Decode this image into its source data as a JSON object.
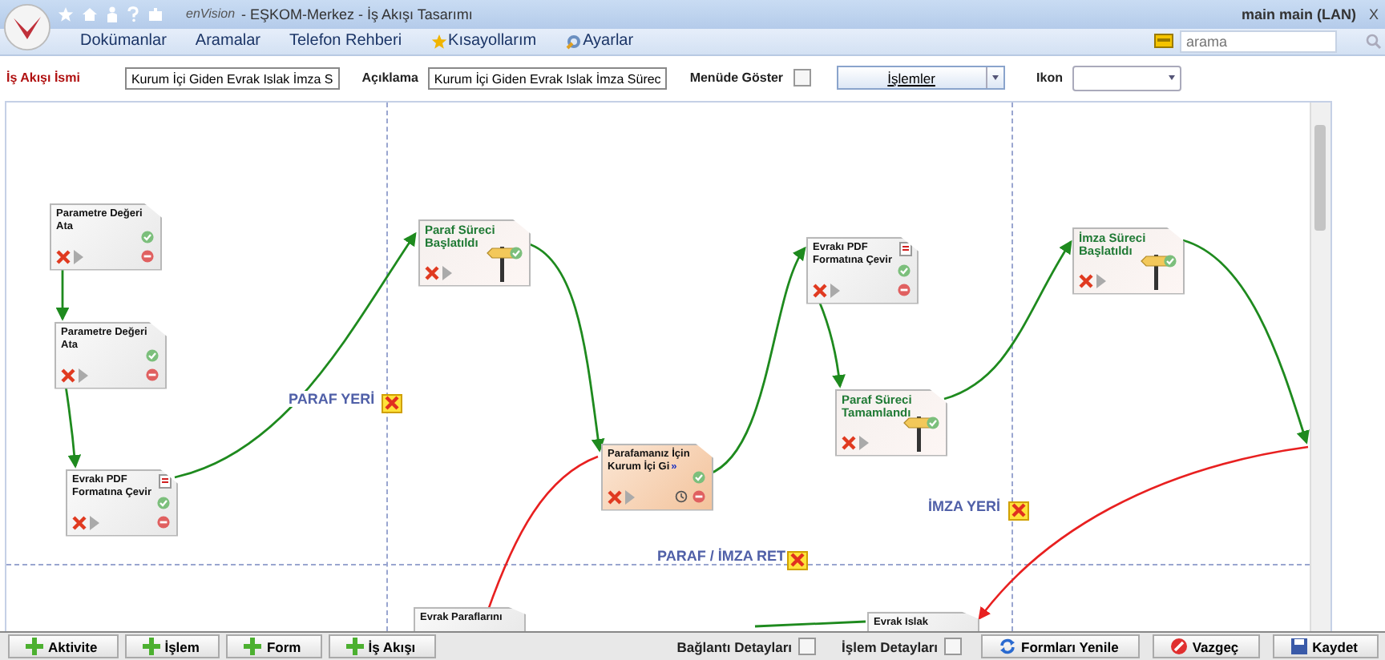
{
  "window": {
    "title": "- EŞKOM-Merkez - İş Akışı Tasarımı",
    "brand": "enVision",
    "user": "main main (LAN)",
    "close": "X"
  },
  "menu": [
    {
      "label": "Dokümanlar"
    },
    {
      "label": "Aramalar"
    },
    {
      "label": "Telefon Rehberi"
    },
    {
      "label": "Kısayollarım"
    },
    {
      "label": "Ayarlar"
    }
  ],
  "search": {
    "placeholder": "arama"
  },
  "form": {
    "name_label": "İş Akışı İsmi",
    "name_value": "Kurum İçi Giden Evrak Islak İmza S",
    "desc_label": "Açıklama",
    "desc_value": "Kurum İçi Giden Evrak Islak İmza Sürec",
    "menu_label": "Menüde Göster",
    "menu_checked": false,
    "actions": "İşlemler",
    "icon_label": "Ikon"
  },
  "lanes": [
    {
      "label": "PARAF YERİ"
    },
    {
      "label": "İMZA YERİ"
    },
    {
      "label": "PARAF / İMZA RET"
    }
  ],
  "nodes": [
    {
      "title": "Parametre Değeri Ata",
      "kind": "task",
      "pdf": false
    },
    {
      "title": "Parametre Değeri Ata",
      "kind": "task",
      "pdf": false
    },
    {
      "title": "Evrakı PDF Formatına Çevir",
      "kind": "task",
      "pdf": true
    },
    {
      "title": "Paraf Süreci Başlatıldı",
      "kind": "milestone",
      "pdf": false
    },
    {
      "title": "Parafamanız İçin Kurum İçi Gi",
      "more": "»",
      "kind": "form",
      "pdf": false
    },
    {
      "title": "Evrakı PDF Formatına Çevir",
      "kind": "task",
      "pdf": true
    },
    {
      "title": "Paraf Süreci Tamamlandı",
      "kind": "milestone",
      "pdf": false
    },
    {
      "title": "İmza Süreci Başlatıldı",
      "kind": "milestone",
      "pdf": false
    },
    {
      "title": "Evrak Paraflarını",
      "kind": "partial",
      "pdf": false
    },
    {
      "title": "Evrak Islak",
      "kind": "partial",
      "pdf": false
    }
  ],
  "add_buttons": [
    "Aktivite",
    "İşlem",
    "Form",
    "İş Akışı"
  ],
  "options": [
    {
      "label": "Bağlantı Detayları",
      "checked": false
    },
    {
      "label": "İşlem Detayları",
      "checked": false
    }
  ],
  "actions": [
    {
      "label": "Formları Yenile",
      "kind": "refresh"
    },
    {
      "label": "Vazgeç",
      "kind": "cancel"
    },
    {
      "label": "Kaydet",
      "kind": "save"
    }
  ]
}
